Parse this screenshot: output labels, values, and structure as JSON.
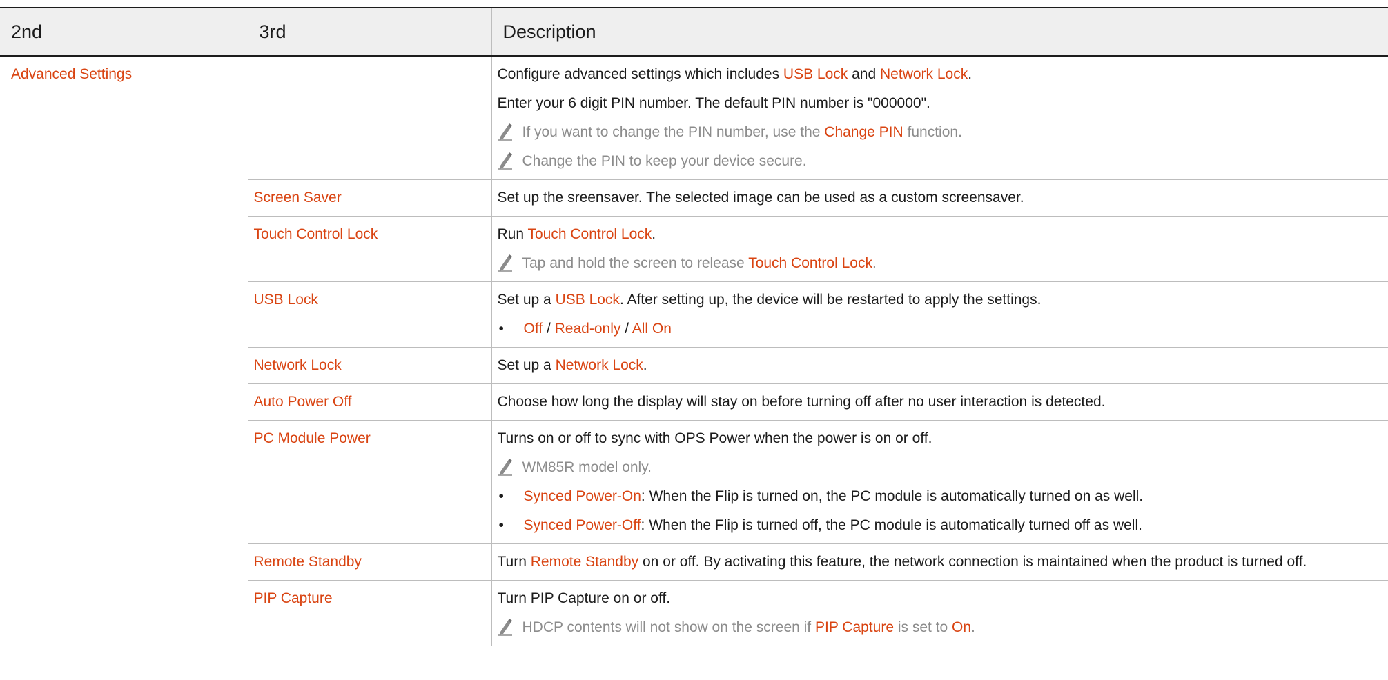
{
  "table": {
    "headers": [
      "2nd",
      "3rd",
      "Description"
    ],
    "group": "Advanced Settings",
    "rows": [
      {
        "name": "",
        "desc": [
          [
            "Configure advanced settings which includes ",
            "USB Lock",
            " and ",
            "Network Lock",
            "."
          ],
          [
            "Enter your 6 digit PIN number. The default PIN number is \"000000\"."
          ]
        ],
        "notes": [
          [
            "If you want to change the PIN number, use the ",
            "Change PIN",
            " function."
          ],
          [
            "Change the PIN to keep your device secure."
          ]
        ]
      },
      {
        "name": "Screen Saver",
        "desc": [
          [
            "Set up the sreensaver. The selected image can be used as a custom screensaver."
          ]
        ]
      },
      {
        "name": "Touch Control Lock",
        "desc": [
          [
            "Run ",
            "Touch Control Lock",
            "."
          ]
        ],
        "notes": [
          [
            "Tap and hold the screen to release ",
            "Touch Control Lock",
            "."
          ]
        ]
      },
      {
        "name": "USB Lock",
        "desc": [
          [
            "Set up a ",
            "USB Lock",
            ". After setting up, the device will be restarted to apply the settings."
          ]
        ],
        "bullets": [
          [
            "",
            "Off",
            " / ",
            "Read-only",
            " / ",
            "All On"
          ]
        ]
      },
      {
        "name": "Network Lock",
        "desc": [
          [
            "Set up a ",
            "Network Lock",
            "."
          ]
        ]
      },
      {
        "name": "Auto Power Off",
        "desc": [
          [
            "Choose how long the display will stay on before turning off after no user interaction is detected."
          ]
        ]
      },
      {
        "name": "PC Module Power",
        "desc": [
          [
            "Turns on or off to sync with OPS Power when the power is on or off."
          ]
        ],
        "notes": [
          [
            "WM85R model only."
          ]
        ],
        "bullets": [
          [
            "",
            "Synced Power-On",
            ": When the Flip is turned on, the PC module is automatically turned on as well."
          ],
          [
            "",
            "Synced Power-Off",
            ": When the Flip is turned off, the PC module is automatically turned off as well."
          ]
        ]
      },
      {
        "name": "Remote Standby",
        "desc": [
          [
            "Turn ",
            "Remote Standby",
            " on or off. By activating this feature, the network connection is maintained when the product is turned off."
          ]
        ]
      },
      {
        "name": "PIP Capture",
        "desc": [
          [
            "Turn PIP Capture on or off."
          ]
        ],
        "notes": [
          [
            "HDCP contents will not show on the screen if ",
            "PIP Capture",
            " is set to ",
            "On",
            "."
          ]
        ]
      }
    ]
  },
  "colors": {
    "highlight": "#d94412",
    "note": "#8c8c8c",
    "header_bg": "#efefef"
  },
  "icons": {
    "note": "pencil-icon"
  }
}
